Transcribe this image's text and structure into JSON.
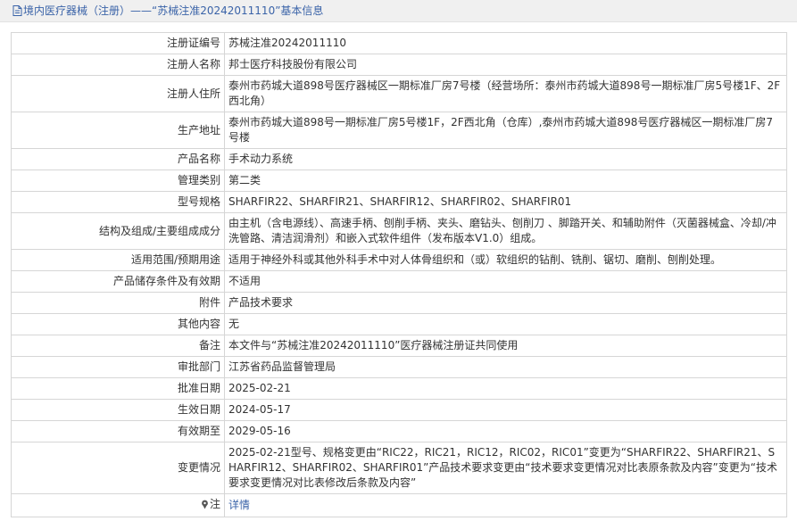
{
  "header": {
    "title": "境内医疗器械（注册）——“苏械注准20242011110”基本信息"
  },
  "rows": [
    {
      "label": "注册证编号",
      "value": "苏械注准20242011110"
    },
    {
      "label": "注册人名称",
      "value": "邦士医疗科技股份有限公司"
    },
    {
      "label": "注册人住所",
      "value": "泰州市药城大道898号医疗器械区一期标准厂房7号楼（经营场所：泰州市药城大道898号一期标准厂房5号楼1F、2F西北角）"
    },
    {
      "label": "生产地址",
      "value": "泰州市药城大道898号一期标准厂房5号楼1F，2F西北角（仓库）,泰州市药城大道898号医疗器械区一期标准厂房7号楼"
    },
    {
      "label": "产品名称",
      "value": "手术动力系统"
    },
    {
      "label": "管理类别",
      "value": "第二类"
    },
    {
      "label": "型号规格",
      "value": "SHARFIR22、SHARFIR21、SHARFIR12、SHARFIR02、SHARFIR01"
    },
    {
      "label": "结构及组成/主要组成成分",
      "value": "由主机（含电源线）、高速手柄、刨削手柄、夹头、磨钻头、刨削刀 、脚踏开关、和辅助附件（灭菌器械盒、冷却/冲洗管路、清洁润滑剂）和嵌入式软件组件（发布版本V1.0）组成。"
    },
    {
      "label": "适用范围/预期用途",
      "value": "适用于神经外科或其他外科手术中对人体骨组织和（或）软组织的钻削、铣削、锯切、磨削、刨削处理。"
    },
    {
      "label": "产品储存条件及有效期",
      "value": "不适用"
    },
    {
      "label": "附件",
      "value": "产品技术要求"
    },
    {
      "label": "其他内容",
      "value": "无"
    },
    {
      "label": "备注",
      "value": "本文件与“苏械注准20242011110”医疗器械注册证共同使用"
    },
    {
      "label": "审批部门",
      "value": "江苏省药品监督管理局"
    },
    {
      "label": "批准日期",
      "value": "2025-02-21"
    },
    {
      "label": "生效日期",
      "value": "2024-05-17"
    },
    {
      "label": "有效期至",
      "value": "2029-05-16"
    },
    {
      "label": "变更情况",
      "value": "2025-02-21型号、规格变更由“RIC22，RIC21，RIC12，RIC02，RIC01”变更为“SHARFIR22、SHARFIR21、SHARFIR12、SHARFIR02、SHARFIR01”产品技术要求变更由“技术要求变更情况对比表原条款及内容”变更为“技术要求变更情况对比表修改后条款及内容”"
    }
  ],
  "note": {
    "label": "注",
    "icon": "pin-icon",
    "link_text": "详情"
  },
  "colors": {
    "link": "#3a63a8",
    "border": "#d6d6d6",
    "header_bg": "#f0f0f0"
  }
}
